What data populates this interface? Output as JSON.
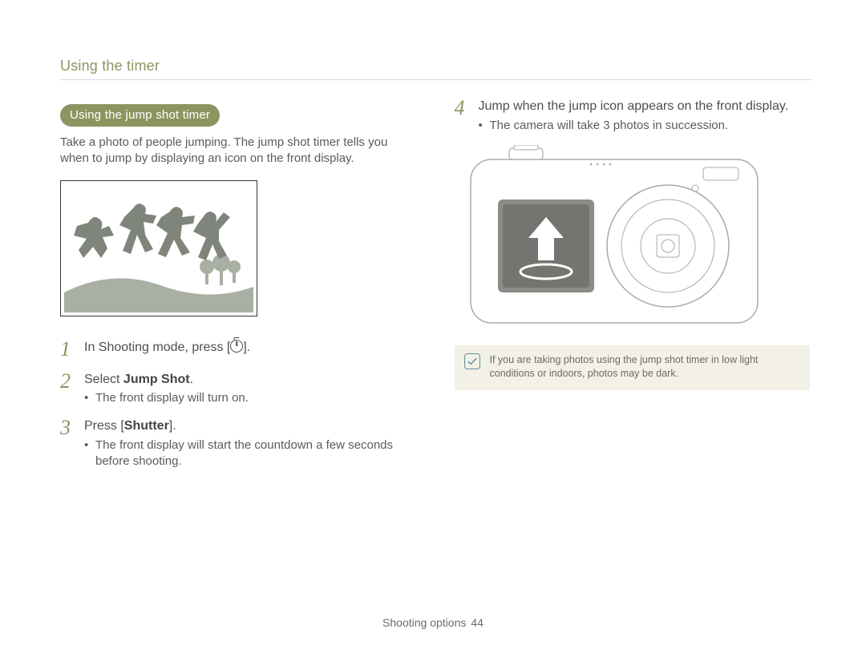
{
  "header": {
    "title": "Using the timer"
  },
  "left": {
    "pill": "Using the jump shot timer",
    "intro": "Take a photo of people jumping. The jump shot timer tells you when to jump by displaying an icon on the front display.",
    "steps": {
      "s1": {
        "num": "1",
        "pre": "In Shooting mode, press [",
        "post": "]."
      },
      "s2": {
        "num": "2",
        "pre": "Select ",
        "bold": "Jump Shot",
        "post": ".",
        "bullet": "The front display will turn on."
      },
      "s3": {
        "num": "3",
        "pre": "Press [",
        "bold": "Shutter",
        "post": "].",
        "bullet": "The front display will start the countdown a few seconds before shooting."
      }
    }
  },
  "right": {
    "s4": {
      "num": "4",
      "text": "Jump when the jump icon appears on the front display.",
      "bullet": "The camera will take 3 photos in succession."
    },
    "note": "If you are taking photos using the jump shot timer in low light conditions or indoors, photos may be dark."
  },
  "footer": {
    "section": "Shooting options",
    "page": "44"
  }
}
